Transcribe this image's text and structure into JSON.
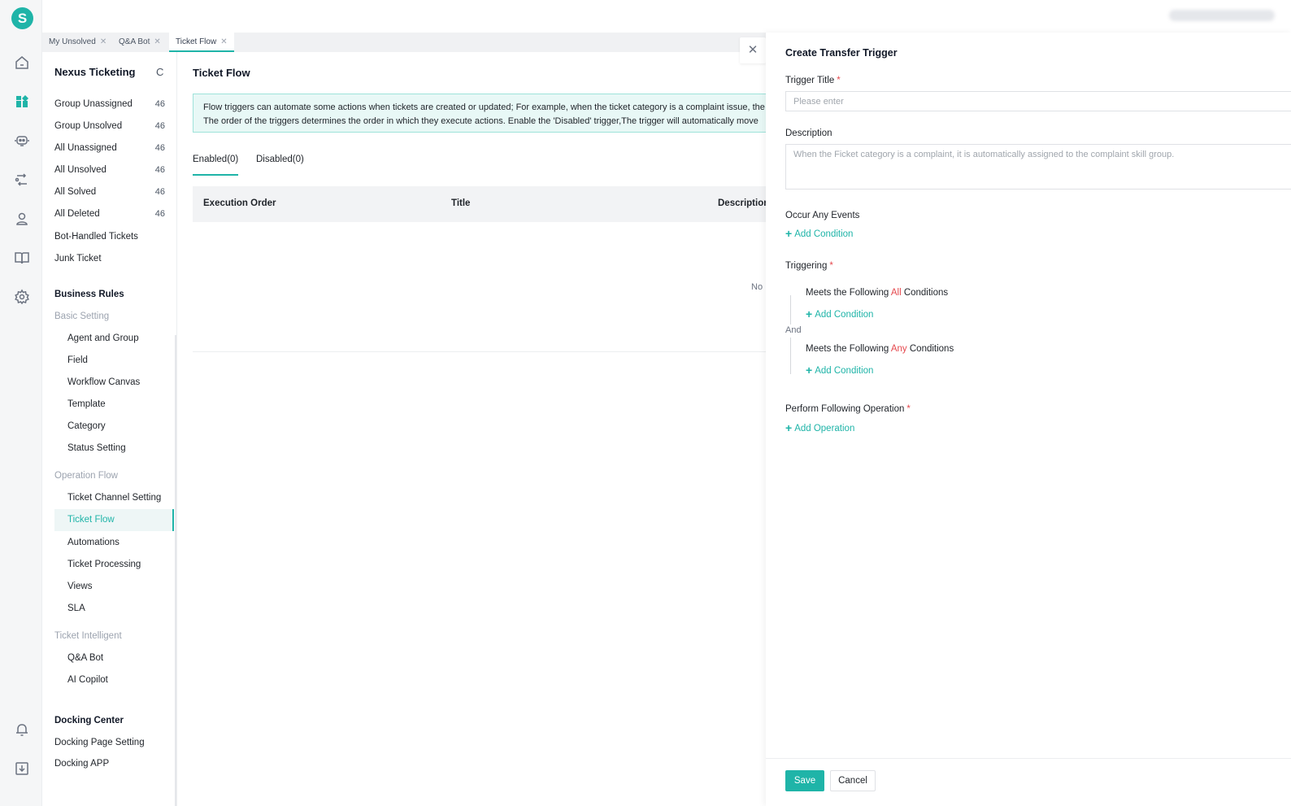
{
  "app": {
    "logo_letter": "S"
  },
  "rail": {
    "icons": [
      "home-icon",
      "dashboard-icon",
      "robot-icon",
      "flow-icon",
      "agent-icon",
      "book-icon",
      "gear-icon",
      "bell-icon",
      "download-icon"
    ],
    "active": "dashboard-icon"
  },
  "tabs": [
    {
      "label": "My Unsolved"
    },
    {
      "label": "Q&A Bot"
    },
    {
      "label": "Ticket Flow"
    }
  ],
  "nav": {
    "title": "Nexus Ticketing",
    "refresh_icon": "C",
    "views": [
      {
        "label": "Group Unassigned",
        "count": "46"
      },
      {
        "label": "Group Unsolved",
        "count": "46"
      },
      {
        "label": "All Unassigned",
        "count": "46"
      },
      {
        "label": "All Unsolved",
        "count": "46"
      },
      {
        "label": "All Solved",
        "count": "46"
      },
      {
        "label": "All Deleted",
        "count": "46"
      },
      {
        "label": "Bot-Handled Tickets",
        "count": ""
      },
      {
        "label": "Junk Ticket",
        "count": ""
      }
    ],
    "business_rules": "Business Rules",
    "basic_setting": "Basic Setting",
    "basic_items": [
      "Agent and Group",
      "Field",
      "Workflow Canvas",
      "Template",
      "Category",
      "Status Setting"
    ],
    "operation_flow": "Operation Flow",
    "operation_items": [
      "Ticket Channel Setting",
      "Ticket Flow",
      "Automations",
      "Ticket Processing",
      "Views",
      "SLA"
    ],
    "ticket_intelligent": "Ticket Intelligent",
    "intelligent_items": [
      "Q&A Bot",
      "AI Copilot"
    ],
    "docking_center": "Docking Center",
    "docking_items": [
      "Docking Page Setting",
      "Docking APP"
    ]
  },
  "main": {
    "title": "Ticket Flow",
    "info_line1": "Flow triggers can automate some actions when tickets are created or updated; For example, when the ticket category is a complaint issue, the",
    "info_line2": "The order of the triggers determines the order in which they execute actions. Enable the 'Disabled' trigger,The trigger will automatically move",
    "tab_enabled": "Enabled(0)",
    "tab_disabled": "Disabled(0)",
    "columns": [
      "Execution Order",
      "Title",
      "Description"
    ],
    "no_data": "No"
  },
  "drawer": {
    "title": "Create Transfer Trigger",
    "trigger_title_label": "Trigger Title",
    "trigger_title_placeholder": "Please enter",
    "description_label": "Description",
    "description_placeholder": "When the Ficket category is a complaint, it is automatically assigned to the complaint skill group.",
    "occur_label": "Occur Any Events",
    "add_condition": "Add Condition",
    "triggering_label": "Triggering",
    "all_prefix": "Meets the Following ",
    "all_word": "All",
    "conditions_suffix": " Conditions",
    "and_label": "And",
    "any_word": "Any",
    "perform_label": "Perform Following Operation",
    "add_operation": "Add Operation",
    "save": "Save",
    "cancel": "Cancel"
  },
  "colors": {
    "accent": "#1fb4a8",
    "required": "#e5484d"
  }
}
